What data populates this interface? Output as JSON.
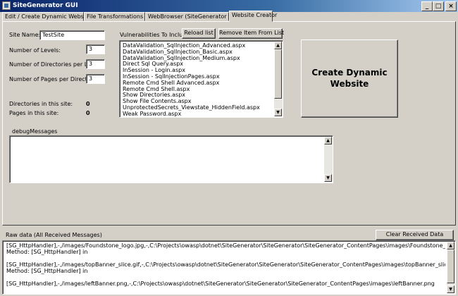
{
  "window": {
    "title": "SiteGenerator GUI",
    "min_glyph": "_",
    "max_glyph": "□",
    "close_glyph": "×"
  },
  "tabs": [
    "Edit / Create Dynamic Websites",
    "File Transformations Log",
    "WebBrowser (SiteGenerator Sites)",
    "Website Creator"
  ],
  "form": {
    "site_name_label": "Site Name:",
    "site_name_value": "TestSite",
    "levels_label": "Number of Levels:",
    "levels_value": "3",
    "dirs_per_level_label": "Number of Directories per Level",
    "dirs_per_level_value": "3",
    "pages_per_dir_label": "Number of Pages per Directory",
    "pages_per_dir_value": "3",
    "dirs_in_site_label": "Directories in this site:",
    "dirs_in_site_value": "0",
    "pages_in_site_label": "Pages in this site:",
    "pages_in_site_value": "0"
  },
  "vulns": {
    "label": "Vulnerabilities To Include",
    "reload_label": "Reload list",
    "remove_label": "Remove Item From List",
    "items": [
      "DataValidation_SqlInjection_Advanced.aspx",
      "DataValidation_SqlInjection_Basic.aspx",
      "DataValidation_SqlInjection_Medium.aspx",
      "Direct Sql Query.aspx",
      "InSession - Login.aspx",
      "InSession - SqlInjectionPages.aspx",
      "Remote Cmd Shell Advanced.aspx",
      "Remote Cmd Shell.aspx",
      "Show Directories.aspx",
      "Show File Contents.aspx",
      "UnprotectedSecrets_Viewstate_HiddenField.aspx",
      "Weak Password.aspx"
    ]
  },
  "create_button": {
    "line1": "Create Dynamic",
    "line2": "Website"
  },
  "debug": {
    "label": "debugMessages"
  },
  "raw": {
    "label": "Raw data (All  Received Messages)",
    "clear_label": "Clear Received Data",
    "lines": [
      "[SG_HttpHandler],-,/images/Foundstone_logo.jpg,-,C:\\Projects\\owasp\\dotnet\\SiteGenerator\\SiteGenerator\\SiteGenerator_ContentPages\\images\\Foundstone_logo.jpg",
      "Method: [SG_HttpHandler] in",
      "",
      "[SG_HttpHandler],-,/images/topBanner_slice.gif,-,C:\\Projects\\owasp\\dotnet\\SiteGenerator\\SiteGenerator\\SiteGenerator_ContentPages\\images\\topBanner_slice.gif",
      "Method: [SG_HttpHandler] in",
      "",
      "[SG_HttpHandler],-,/images/leftBanner.png,-,C:\\Projects\\owasp\\dotnet\\SiteGenerator\\SiteGenerator\\SiteGenerator_ContentPages\\images\\leftBanner.png"
    ]
  },
  "scroll_up_glyph": "▲",
  "scroll_down_glyph": "▼"
}
